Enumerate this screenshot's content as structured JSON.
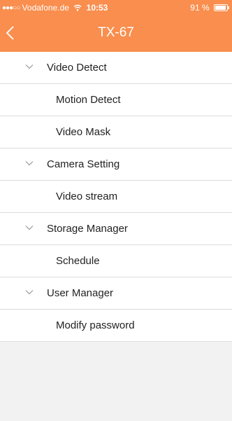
{
  "status_bar": {
    "signal": "●●●○○",
    "carrier": "Vodafone.de",
    "time": "10:53",
    "battery": "91 %",
    "battery_level": 0.91
  },
  "header": {
    "title": "TX-67",
    "back_icon": "chevron-left-icon",
    "background_color": "#f98e4e"
  },
  "menu": {
    "sections": [
      {
        "label": "Video Detect",
        "items": [
          "Motion Detect",
          "Video Mask"
        ]
      },
      {
        "label": "Camera Setting",
        "items": [
          "Video stream"
        ]
      },
      {
        "label": "Storage Manager",
        "items": [
          "Schedule"
        ]
      },
      {
        "label": "User Manager",
        "items": [
          "Modify password"
        ]
      }
    ]
  }
}
